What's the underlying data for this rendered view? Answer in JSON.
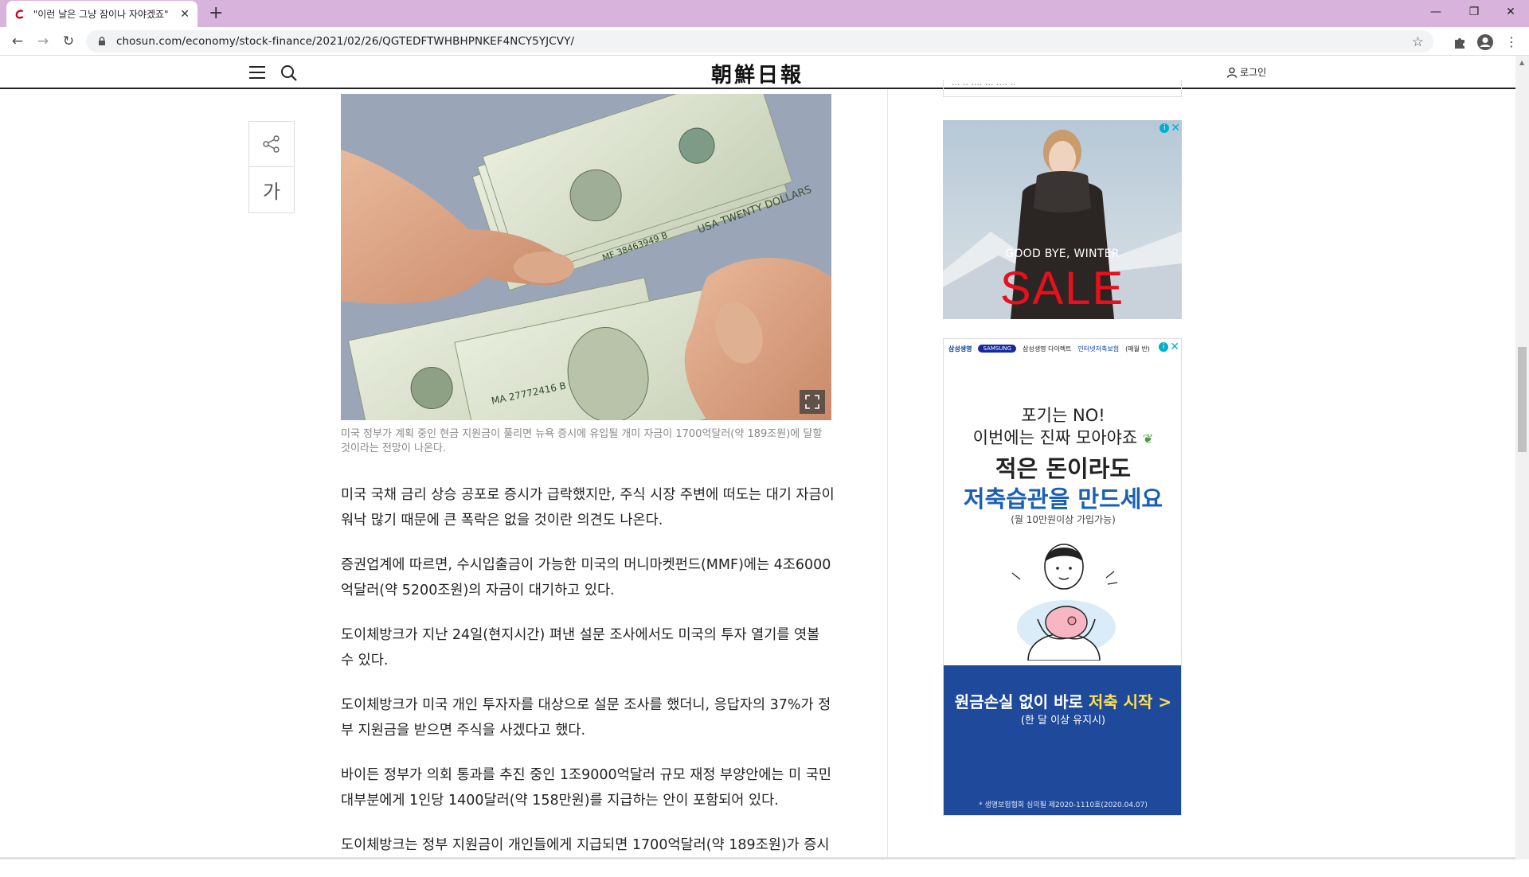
{
  "browser": {
    "tab_title": "\"이런 날은 그냥 잠이나 자야겠죠\"",
    "url": "chosun.com/economy/stock-finance/2021/02/26/QGTEDFTWHBHPNKEF4NCY5YJCVY/",
    "new_tab_label": "+"
  },
  "site": {
    "logo": "朝鮮日報",
    "login_label": "로그인"
  },
  "article": {
    "font_button_label": "가",
    "image_caption": "미국 정부가 계획 중인 현금 지원금이 풀리면 뉴욕 증시에 유입될 개미 자금이 1700억달러(약 189조원)에 달할 것이라는 전망이 나온다.",
    "photo_texts": [
      "USA TWENTY DOLLARS",
      "MF 38463949 B",
      "MA 27772416 B"
    ],
    "paragraphs": [
      "미국 국채 금리 상승 공포로 증시가 급락했지만, 주식 시장 주변에 떠도는 대기 자금이 워낙 많기 때문에 큰 폭락은 없을 것이란 의견도 나온다.",
      "증권업계에 따르면, 수시입출금이 가능한 미국의 머니마켓펀드(MMF)에는 4조6000억달러(약 5200조원)의 자금이 대기하고 있다.",
      "도이체방크가 지난 24일(현지시간) 펴낸 설문 조사에서도 미국의 투자 열기를 엿볼 수 있다.",
      "도이체방크가 미국 개인 투자자를 대상으로 설문 조사를 했더니, 응답자의 37%가 정부 지원금을 받으면 주식을 사겠다고 했다.",
      "바이든 정부가 의회 통과를 추진 중인 1조9000억달러 규모 재정 부양안에는 미 국민 대부분에게 1인당 1400달러(약 158만원)를 지급하는 안이 포함되어 있다.",
      "도이체방크는 정부 지원금이 개인들에게 지급되면 1700억달러(약 189조원)가 증시"
    ]
  },
  "sidebar": {
    "prev_item_text": "··· ·· ···· ··· ···· ··",
    "ad1": {
      "line1": "GOOD BYE, WINTER",
      "line2": "SALE"
    },
    "ad2": {
      "brand1": "삼성생명",
      "brand2": "SAMSUNG",
      "brand3": "삼성생명 다이렉트",
      "brand4": "인터넷저축보험",
      "brand5": "(매월 반)",
      "head1": "포기는 NO!",
      "head2": "이번에는 진짜 모아야죠",
      "big1": "적은 돈이라도",
      "big2": "저축습관을 만드세요",
      "note": "(월 10만원이상 가입가능)",
      "cta_main": "원금손실 없이 바로 ",
      "cta_highlight": "저축 시작 >",
      "cta_sub": "(한 달 이상 유지시)",
      "footnote": "* 생명보험협회 심의필 제2020-1110호(2020.04.07)"
    }
  },
  "colors": {
    "tabstrip": "#d8b3dc",
    "accent_blue": "#1a5fb4",
    "ad_red": "#e8101c"
  }
}
